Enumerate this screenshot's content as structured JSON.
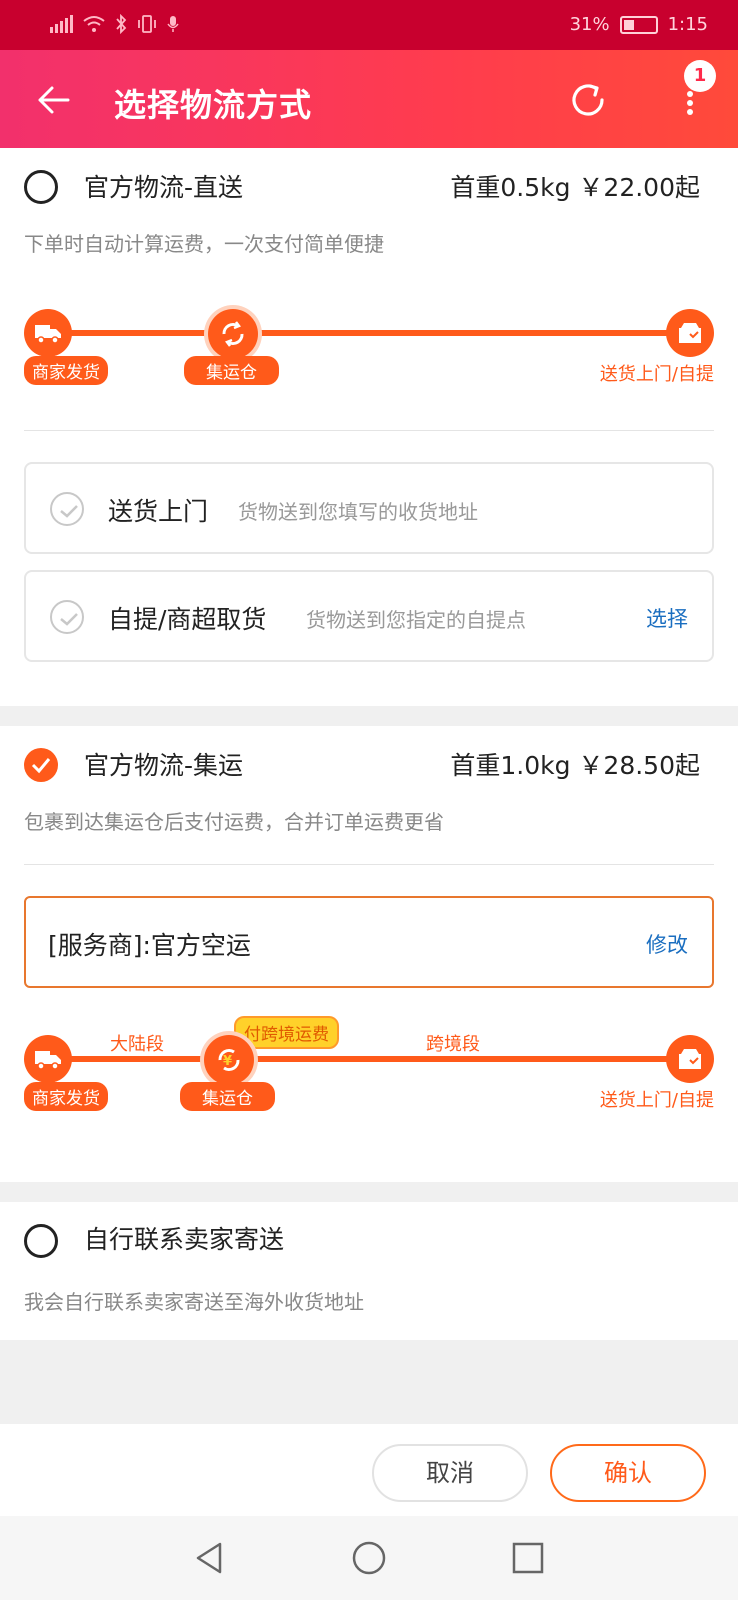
{
  "status": {
    "battery_pct": "31%",
    "time": "1:15",
    "icons": [
      "signal-icon",
      "wifi-icon",
      "bluetooth-icon",
      "vibrate-icon",
      "mic-icon",
      "battery-icon"
    ]
  },
  "header": {
    "title": "选择物流方式",
    "badge_count": "1",
    "icons": [
      "back-arrow-icon",
      "refresh-icon",
      "more-vertical-icon"
    ]
  },
  "options": [
    {
      "title": "官方物流-直送",
      "price": "首重0.5kg ￥22.00起",
      "desc": "下单时自动计算运费，一次支付简单便捷",
      "selected": false,
      "track": {
        "start_label": "商家发货",
        "mid_label": "集运仓",
        "end_label": "送货上门/自提"
      },
      "delivery": [
        {
          "title": "送货上门",
          "desc": "货物送到您填写的收货地址"
        },
        {
          "title": "自提/商超取货",
          "desc": "货物送到您指定的自提点",
          "action": "选择"
        }
      ]
    },
    {
      "title": "官方物流-集运",
      "price": "首重1.0kg ￥28.50起",
      "desc": "包裹到达集运仓后支付运费，合并订单运费更省",
      "selected": true,
      "provider": {
        "text": "[服务商]:官方空运",
        "action": "修改"
      },
      "track": {
        "start_label": "商家发货",
        "mid_label": "集运仓",
        "end_label": "送货上门/自提",
        "seg1": "大陆段",
        "seg2": "跨境段",
        "pay_tag": "付跨境运费"
      }
    },
    {
      "title": "自行联系卖家寄送",
      "desc": "我会自行联系卖家寄送至海外收货地址",
      "selected": false
    }
  ],
  "footer": {
    "cancel": "取消",
    "confirm": "确认"
  },
  "colors": {
    "status_bar": "#c8002e",
    "header_start": "#f2306c",
    "header_end": "#ff4a3a",
    "accent_orange": "#ff5a1a",
    "link_blue": "#1a6ec0"
  }
}
